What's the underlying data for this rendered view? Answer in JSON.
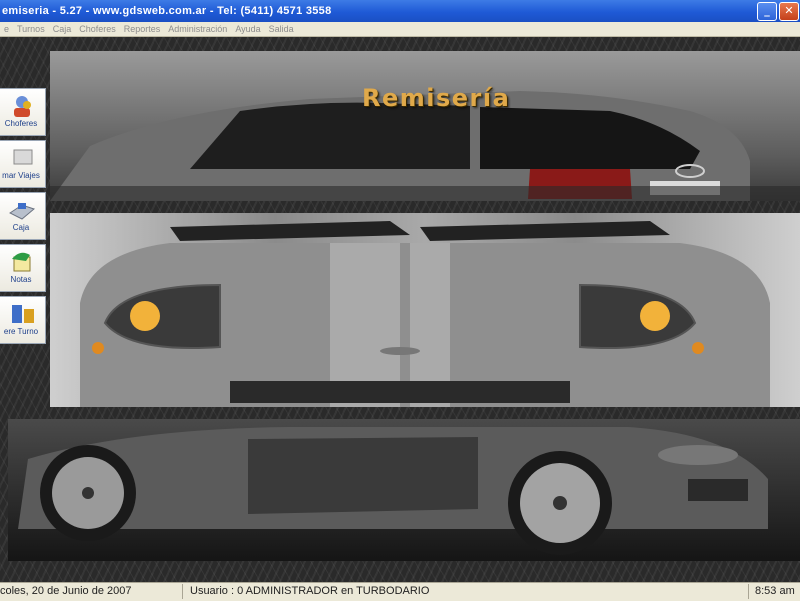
{
  "window": {
    "title": "emiseria - 5.27 - www.gdsweb.com.ar - Tel: (5411) 4571 3558",
    "minimize_glyph": "_",
    "close_glyph": "✕"
  },
  "menu": [
    "e",
    "Turnos",
    "Caja",
    "Choferes",
    "Reportes",
    "Administración",
    "Ayuda",
    "Salida"
  ],
  "brand": {
    "title": "Remisería"
  },
  "sidebar": {
    "items": [
      {
        "label": "Choferes",
        "icon": "drivers-icon"
      },
      {
        "label": "mar Viajes",
        "icon": "trips-icon"
      },
      {
        "label": "Caja",
        "icon": "cash-register-icon"
      },
      {
        "label": "Notas",
        "icon": "notes-icon"
      },
      {
        "label": "ere Turno",
        "icon": "shift-icon"
      }
    ]
  },
  "status": {
    "date": "coles, 20 de Junio de 2007",
    "user": "Usuario : 0 ADMINISTRADOR en TURBODARIO",
    "time": "8:53 am"
  },
  "colors": {
    "titlebar": "#1f5ad6",
    "brand_title": "#e0a94a",
    "statusbar": "#ece9d8"
  }
}
